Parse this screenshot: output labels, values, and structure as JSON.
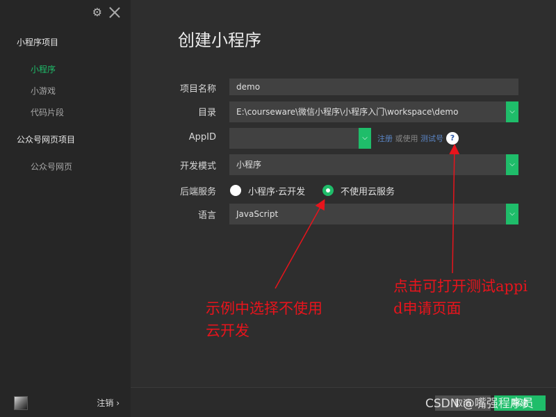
{
  "sidebar": {
    "sections": [
      {
        "title": "小程序项目",
        "items": [
          {
            "label": "小程序",
            "active": true
          },
          {
            "label": "小游戏",
            "active": false
          },
          {
            "label": "代码片段",
            "active": false
          }
        ]
      },
      {
        "title": "公众号网页项目",
        "items": [
          {
            "label": "公众号网页",
            "active": false
          }
        ]
      }
    ],
    "logout_label": "注销 ›",
    "icons": [
      "gear-icon",
      "close-icon",
      "avatar"
    ]
  },
  "main": {
    "title": "创建小程序",
    "form": {
      "project_name": {
        "label": "项目名称",
        "value": "demo"
      },
      "directory": {
        "label": "目录",
        "value": "E:\\courseware\\微信小程序\\小程序入门\\workspace\\demo"
      },
      "appid": {
        "label": "AppID",
        "value": "",
        "register_text": "注册",
        "or_use_text": "或使用",
        "test_account_text": "测试号",
        "help_text": "?"
      },
      "dev_mode": {
        "label": "开发模式",
        "value": "小程序"
      },
      "backend": {
        "label": "后端服务",
        "options": [
          "小程序·云开发",
          "不使用云服务"
        ],
        "selected": "不使用云服务"
      },
      "language": {
        "label": "语言",
        "value": "JavaScript"
      }
    }
  },
  "annotations": {
    "left_line1": "示例中选择不使用",
    "left_line2": "云开发",
    "right_line1": "点击可打开测试appi",
    "right_line2": "d申请页面"
  },
  "footer": {
    "cancel_label": "取消",
    "create_label": "新建"
  },
  "watermark": "CSDN @嘴强程序员",
  "colors": {
    "accent": "#1fbd6a",
    "annotation": "#e8141c",
    "link": "#5b86c6"
  }
}
